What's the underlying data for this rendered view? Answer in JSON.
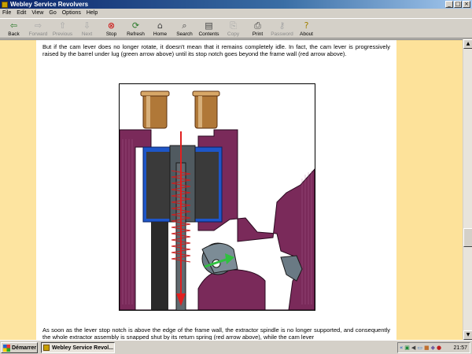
{
  "window": {
    "title": "Webley Service Revolvers"
  },
  "menu": [
    "File",
    "Edit",
    "View",
    "Go",
    "Options",
    "Help"
  ],
  "toolbar": [
    {
      "label": "Back",
      "icon": "back-arrow-icon",
      "glyph": "⇦",
      "color": "#2a7a2a",
      "enabled": true
    },
    {
      "label": "Forward",
      "icon": "forward-arrow-icon",
      "glyph": "⇨",
      "color": "#2a7a2a",
      "enabled": false
    },
    {
      "label": "Previous",
      "icon": "up-arrow-icon",
      "glyph": "⇧",
      "color": "#2a7a2a",
      "enabled": false
    },
    {
      "label": "Next",
      "icon": "down-arrow-icon",
      "glyph": "⇩",
      "color": "#2a7a2a",
      "enabled": false
    },
    {
      "label": "Stop",
      "icon": "stop-icon",
      "glyph": "⊗",
      "color": "#cc0000",
      "enabled": true
    },
    {
      "label": "Refresh",
      "icon": "refresh-icon",
      "glyph": "⟳",
      "color": "#2a7a2a",
      "enabled": true
    },
    {
      "label": "Home",
      "icon": "home-icon",
      "glyph": "⌂",
      "color": "#444444",
      "enabled": true
    },
    {
      "label": "Search",
      "icon": "search-icon",
      "glyph": "⌕",
      "color": "#444444",
      "enabled": true
    },
    {
      "label": "Contents",
      "icon": "contents-icon",
      "glyph": "▤",
      "color": "#444444",
      "enabled": true
    },
    {
      "label": "Copy",
      "icon": "copy-icon",
      "glyph": "⎘",
      "color": "#444444",
      "enabled": false
    },
    {
      "label": "Print",
      "icon": "print-icon",
      "glyph": "⎙",
      "color": "#444444",
      "enabled": true
    },
    {
      "label": "Password",
      "icon": "key-icon",
      "glyph": "⚷",
      "color": "#444444",
      "enabled": false
    },
    {
      "label": "About",
      "icon": "about-bulb-icon",
      "glyph": "?",
      "color": "#a08000",
      "enabled": true
    }
  ],
  "document": {
    "para1": "But if the cam lever does no longer rotate, it doesn't mean that it remains completely idle. In fact, the cam lever is progressively raised by the barrel under lug (green arrow above) until its stop notch goes beyond the frame wall (red arrow above).",
    "para2": "As soon as the lever stop notch is above the edge of the frame wall, the extractor spindle is no longer supported, and consequently the whole extractor assembly is snapped shut by its return spring (red arrow above), while the cam lever"
  },
  "colors": {
    "frame": "#7a2a5a",
    "cylinder": "#2a2a2a",
    "cylinder_blue": "#1e56c8",
    "spring": "#cc2020",
    "arrow_red": "#e02020",
    "arrow_green": "#30c040",
    "cartridge": "#b07838",
    "lever": "#6a7a84"
  },
  "taskbar": {
    "start_label": "Démarrer",
    "task_label": "Webley Service Revol...",
    "clock": "21:57"
  }
}
